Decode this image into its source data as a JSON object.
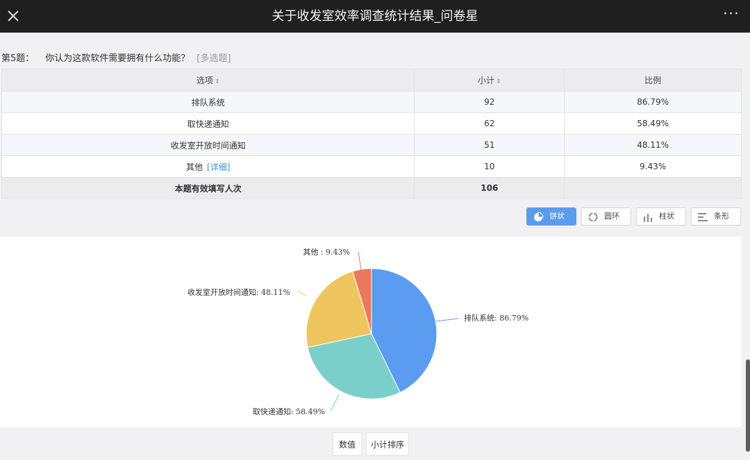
{
  "window": {
    "title": "关于收发室效率调查统计结果_问卷星"
  },
  "question": {
    "number": "第5题：",
    "text": "你认为这款软件需要拥有什么功能？",
    "type": "[多选题]"
  },
  "table": {
    "headers": {
      "option": "选项",
      "count": "小计",
      "ratio": "比例"
    },
    "rows": [
      {
        "option": "排队系统",
        "count": "92",
        "ratio": "86.79%"
      },
      {
        "option": "取快递通知",
        "count": "62",
        "ratio": "58.49%"
      },
      {
        "option": "收发室开放时间通知",
        "count": "51",
        "ratio": "48.11%"
      },
      {
        "option": "其他",
        "detail": "[详细]",
        "count": "10",
        "ratio": "9.43%"
      }
    ],
    "footer": {
      "label": "本题有效填写人次",
      "total": "106"
    }
  },
  "chart_types": {
    "active": "pie",
    "items": [
      {
        "id": "pie",
        "label": "饼状",
        "icon": "pie-icon"
      },
      {
        "id": "ring",
        "label": "圆环",
        "icon": "ring-icon"
      },
      {
        "id": "column",
        "label": "柱状",
        "icon": "column-icon"
      },
      {
        "id": "bar",
        "label": "条形",
        "icon": "bar-icon"
      }
    ]
  },
  "chart_data": {
    "type": "pie",
    "slices": [
      {
        "label": "排队系统",
        "value": 86.79,
        "display": "排队系统: 86.79%",
        "color": "#5b9cf0"
      },
      {
        "label": "取快递通知",
        "value": 58.49,
        "display": "取快递通知: 58.49%",
        "color": "#7bcfca"
      },
      {
        "label": "收发室开放时间通知",
        "value": 48.11,
        "display": "收发室开放时间通知: 48.11%",
        "color": "#efc55f"
      },
      {
        "label": "其他",
        "value": 9.43,
        "display": "其他 : 9.43%",
        "color": "#e8795a"
      }
    ]
  },
  "bottom_buttons": {
    "value": "数值",
    "sort": "小计排序"
  }
}
